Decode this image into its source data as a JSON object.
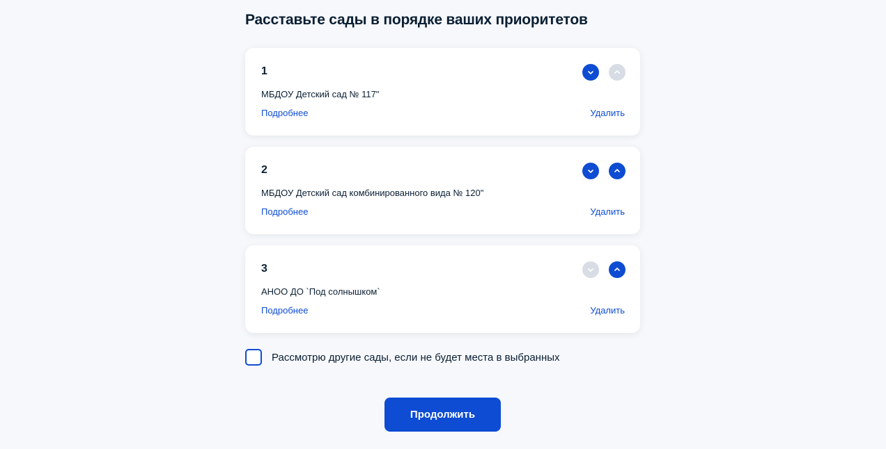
{
  "page": {
    "title": "Расставьте сады в порядке ваших приоритетов"
  },
  "cards": [
    {
      "number": "1",
      "name": "МБДОУ Детский сад № 117\"",
      "more_label": "Подробнее",
      "delete_label": "Удалить",
      "down_enabled": true,
      "up_enabled": false
    },
    {
      "number": "2",
      "name": "МБДОУ Детский сад комбинированного вида № 120\"",
      "more_label": "Подробнее",
      "delete_label": "Удалить",
      "down_enabled": true,
      "up_enabled": true
    },
    {
      "number": "3",
      "name": "АНОО ДО `Под солнышком`",
      "more_label": "Подробнее",
      "delete_label": "Удалить",
      "down_enabled": false,
      "up_enabled": true
    }
  ],
  "other_gardens": {
    "label": "Рассмотрю другие сады, если не будет места в выбранных",
    "checked": false
  },
  "continue_button": {
    "label": "Продолжить"
  },
  "icons": {
    "move_down": "chevron-down-icon",
    "move_up": "chevron-up-icon"
  },
  "colors": {
    "accent": "#0d4cd3",
    "disabled": "#d8dde5",
    "background": "#f6f8fb",
    "text": "#0b1f33"
  }
}
